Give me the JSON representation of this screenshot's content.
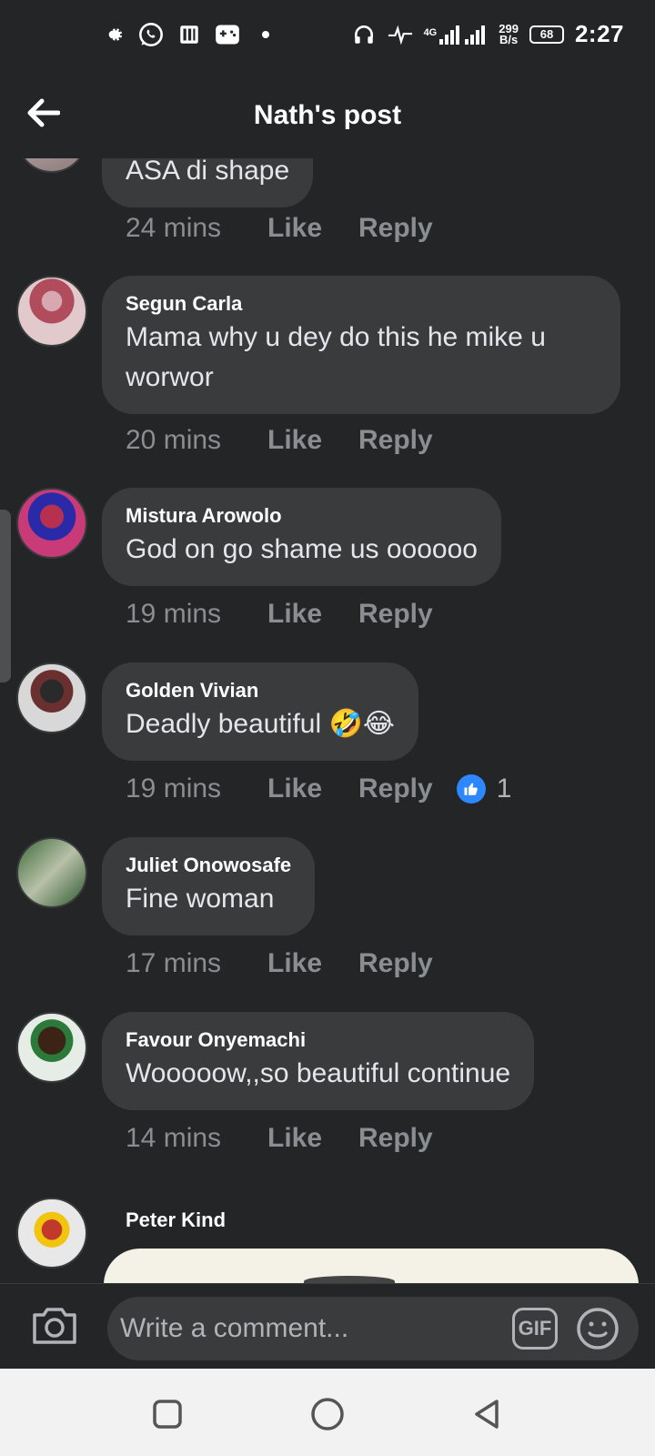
{
  "status_bar": {
    "time": "2:27",
    "battery": "68",
    "speed_value": "299",
    "speed_unit": "B/s",
    "network": "4G",
    "icons": [
      "gear-icon",
      "whatsapp-icon",
      "sim-icon",
      "gamepad-icon",
      "dot-icon",
      "headphones-icon",
      "activity-icon",
      "signal-icon",
      "battery-icon"
    ]
  },
  "header": {
    "title": "Nath's post",
    "back_icon": "arrow-left-icon"
  },
  "comments": [
    {
      "author": "",
      "text": "ASA di shape",
      "time": "24 mins",
      "like": "Like",
      "reply": "Reply"
    },
    {
      "author": "Segun Carla",
      "text": "Mama why u dey do this he mike u worwor",
      "time": "20 mins",
      "like": "Like",
      "reply": "Reply"
    },
    {
      "author": "Mistura Arowolo",
      "text": "God on go shame us oooooo",
      "time": "19 mins",
      "like": "Like",
      "reply": "Reply"
    },
    {
      "author": "Golden Vivian",
      "text": "Deadly beautiful 🤣😂",
      "time": "19 mins",
      "like": "Like",
      "reply": "Reply",
      "reaction_count": "1"
    },
    {
      "author": "Juliet Onowosafe",
      "text": "Fine woman",
      "time": "17 mins",
      "like": "Like",
      "reply": "Reply"
    },
    {
      "author": "Favour Onyemachi",
      "text": "Wooooow,,so beautiful continue",
      "time": "14 mins",
      "like": "Like",
      "reply": "Reply"
    },
    {
      "author": "Peter Kind",
      "text": "",
      "time": "",
      "like": "",
      "reply": ""
    }
  ],
  "compose": {
    "placeholder": "Write a comment...",
    "gif_label": "GIF"
  },
  "colors": {
    "background": "#242526",
    "bubble": "#3a3b3c",
    "meta_text": "#8a8d91",
    "like_blue": "#2d88ff",
    "navbar": "#f2f2f2"
  }
}
